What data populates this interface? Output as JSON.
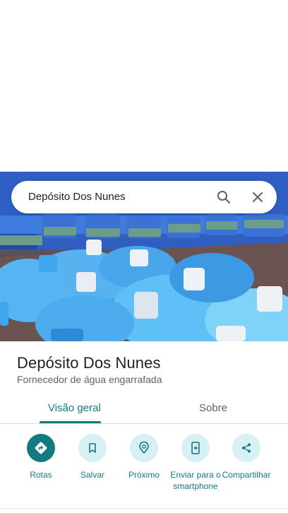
{
  "search": {
    "query": "Depósito Dos Nunes"
  },
  "place": {
    "name": "Depósito Dos Nunes",
    "category": "Fornecedor de água engarrafada"
  },
  "tabs": [
    {
      "label": "Visão geral",
      "selected": true
    },
    {
      "label": "Sobre",
      "selected": false
    }
  ],
  "actions": [
    {
      "label": "Rotas",
      "icon": "directions-icon"
    },
    {
      "label": "Salvar",
      "icon": "bookmark-icon"
    },
    {
      "label": "Próximo",
      "icon": "nearby-icon"
    },
    {
      "label": "Enviar para o smartphone",
      "icon": "send-to-phone-icon"
    },
    {
      "label": "Compartilhar",
      "icon": "share-icon"
    }
  ],
  "colors": {
    "accent": "#137a7f",
    "action_bg": "#d6f0f3"
  }
}
